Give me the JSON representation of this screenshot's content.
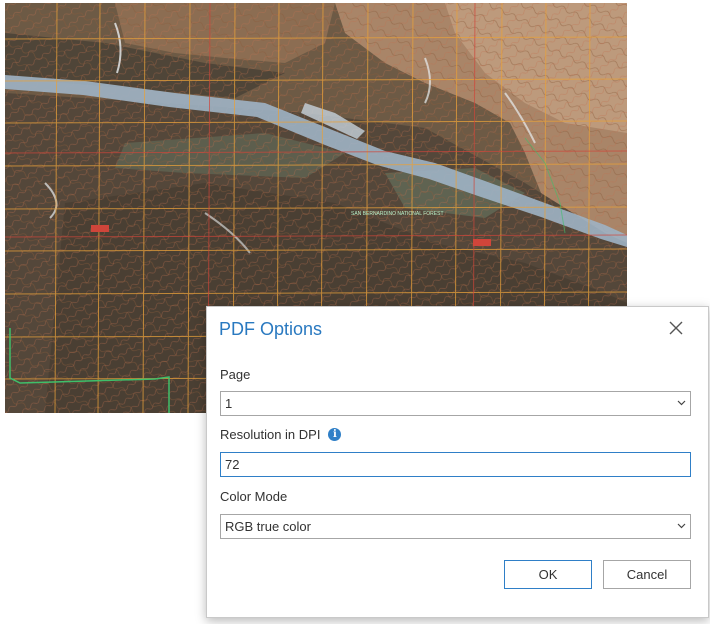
{
  "dialog": {
    "title": "PDF Options",
    "page_label": "Page",
    "page_value": "1",
    "resolution_label": "Resolution in DPI",
    "resolution_value": "72",
    "color_mode_label": "Color Mode",
    "color_mode_value": "RGB true color",
    "ok_label": "OK",
    "cancel_label": "Cancel"
  },
  "map": {
    "labels": [
      "SAN BERNARDINO NATIONAL FOREST"
    ]
  },
  "colors": {
    "accent": "#2979c0",
    "focus_border": "#2f7fc7",
    "terrain_dark": "#4e3f2f",
    "terrain_light": "#b08d6c",
    "river": "#9fb3c4",
    "grid_orange": "#e8a13a",
    "boundary_green": "#3fbf6a"
  },
  "icons": {
    "close": "close-icon",
    "info": "info-icon",
    "dropdown": "chevron-down-icon"
  }
}
